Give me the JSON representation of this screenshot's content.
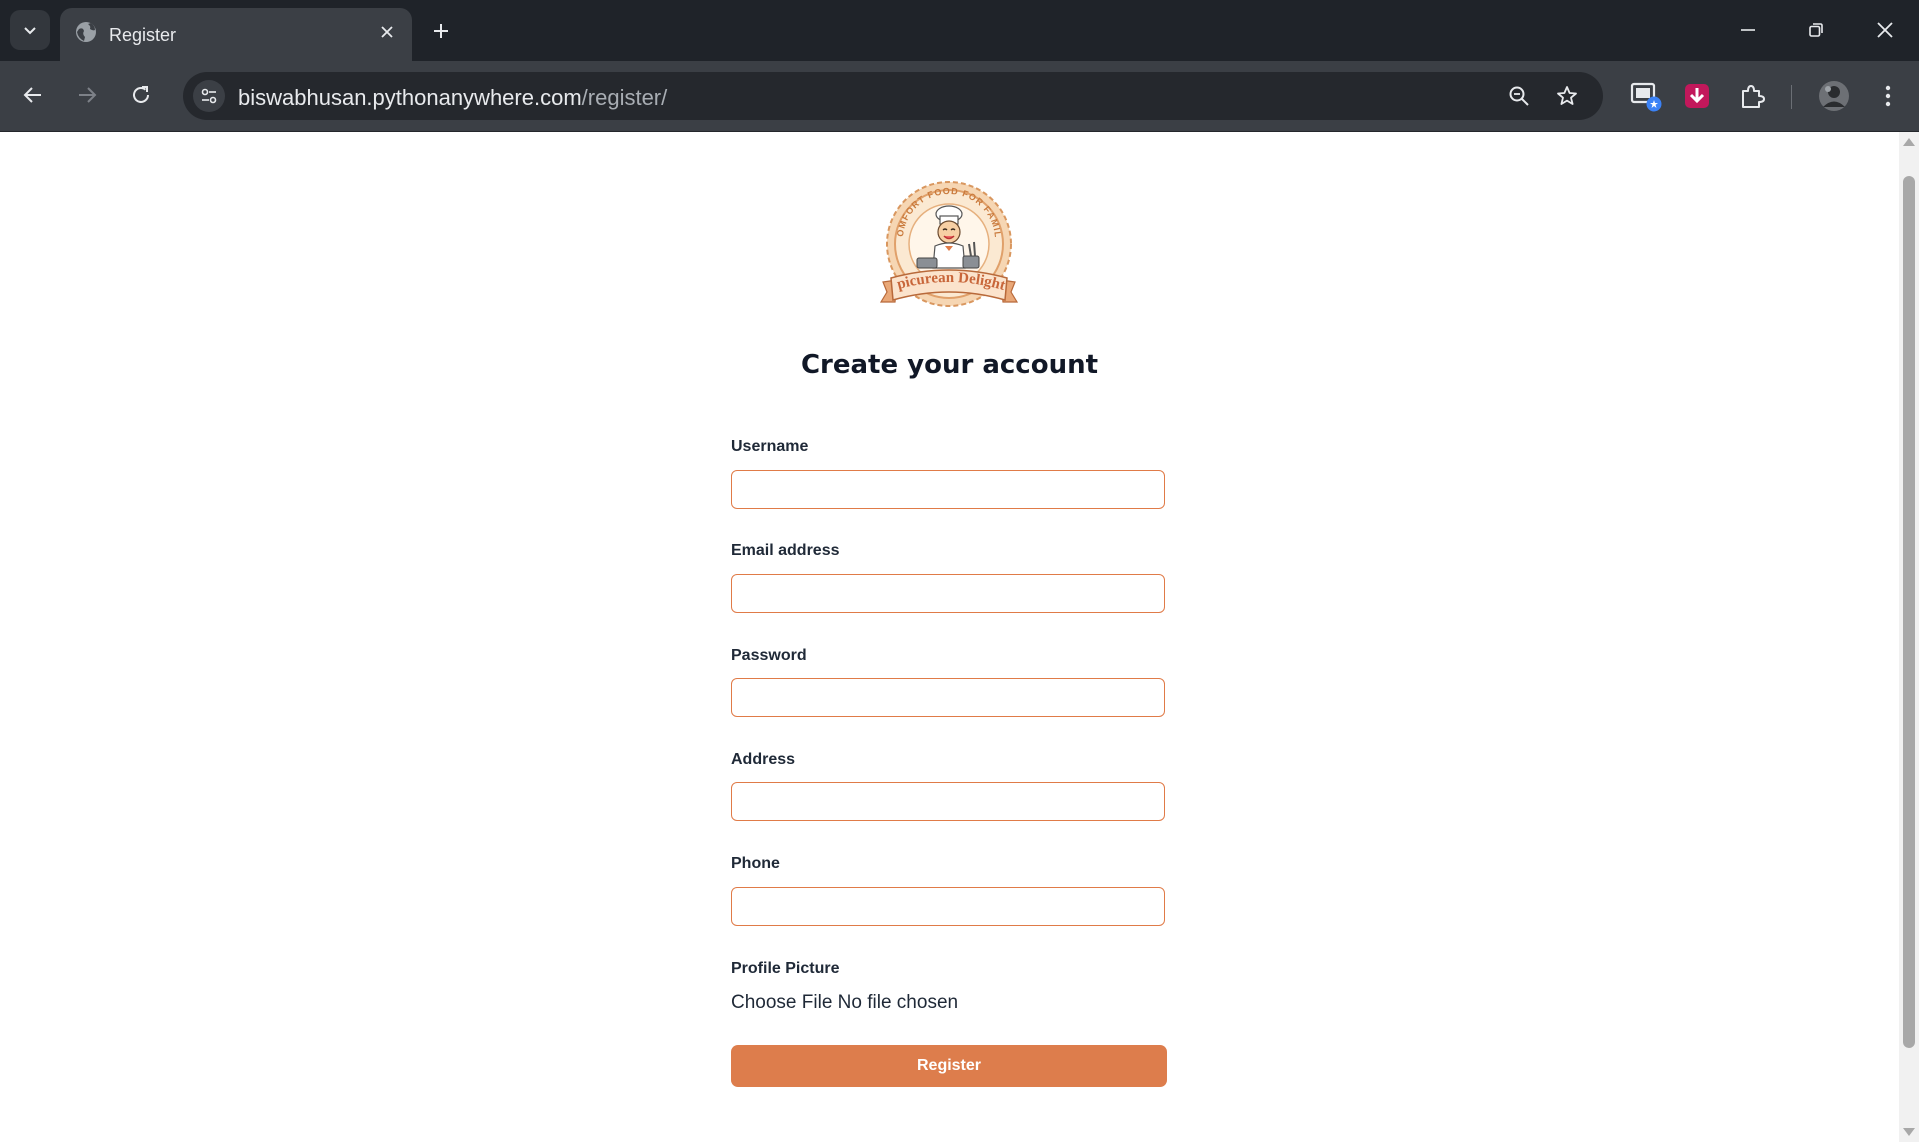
{
  "browser": {
    "tab_title": "Register",
    "url_host": "biswabhusan.pythonanywhere.com",
    "url_path": "/register/",
    "icons": [
      "chevron-down-icon",
      "globe-icon",
      "close-icon",
      "plus-icon",
      "minimize-icon",
      "restore-icon",
      "back-arrow-icon",
      "forward-arrow-icon",
      "reload-icon",
      "site-settings-icon",
      "zoom-icon",
      "star-icon",
      "extension-icon",
      "download-extension-icon",
      "puzzle-icon",
      "profile-avatar",
      "more-vert-icon"
    ]
  },
  "logo": {
    "arc_text": "COMFORT FOOD FOR FAMILY",
    "banner_text": "Epicurean Delights"
  },
  "page": {
    "heading": "Create your account"
  },
  "form": {
    "username_label": "Username",
    "email_label": "Email address",
    "password_label": "Password",
    "address_label": "Address",
    "phone_label": "Phone",
    "picture_label": "Profile Picture",
    "choose_file": "Choose File",
    "no_file": "No file chosen",
    "submit": "Register"
  },
  "colors": {
    "accent": "#dd7d4c",
    "input_border": "#e07b48",
    "chrome_dark": "#1f2329",
    "chrome_toolbar": "#3b3f45"
  }
}
